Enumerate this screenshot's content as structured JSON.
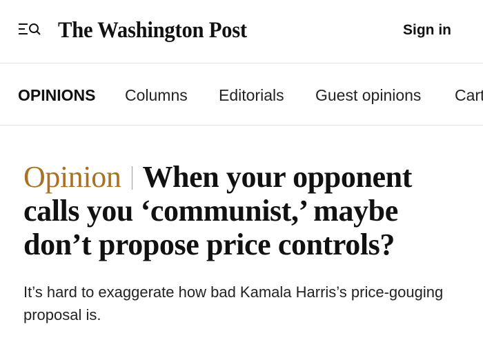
{
  "header": {
    "logo": "The Washington Post",
    "sign_in": "Sign in",
    "menu_icon": "menu-search-icon"
  },
  "nav": {
    "section": "OPINIONS",
    "items": [
      "Columns",
      "Editorials",
      "Guest opinions",
      "Cart"
    ]
  },
  "article": {
    "kicker": "Opinion",
    "headline": "When your opponent calls you ‘communist,’ maybe don’t propose price controls?",
    "dek": "It’s hard to exaggerate how bad Kamala Harris’s price-gouging proposal is."
  },
  "colors": {
    "kicker": "#a87222",
    "text": "#111111",
    "divider": "#e3e3e3"
  }
}
